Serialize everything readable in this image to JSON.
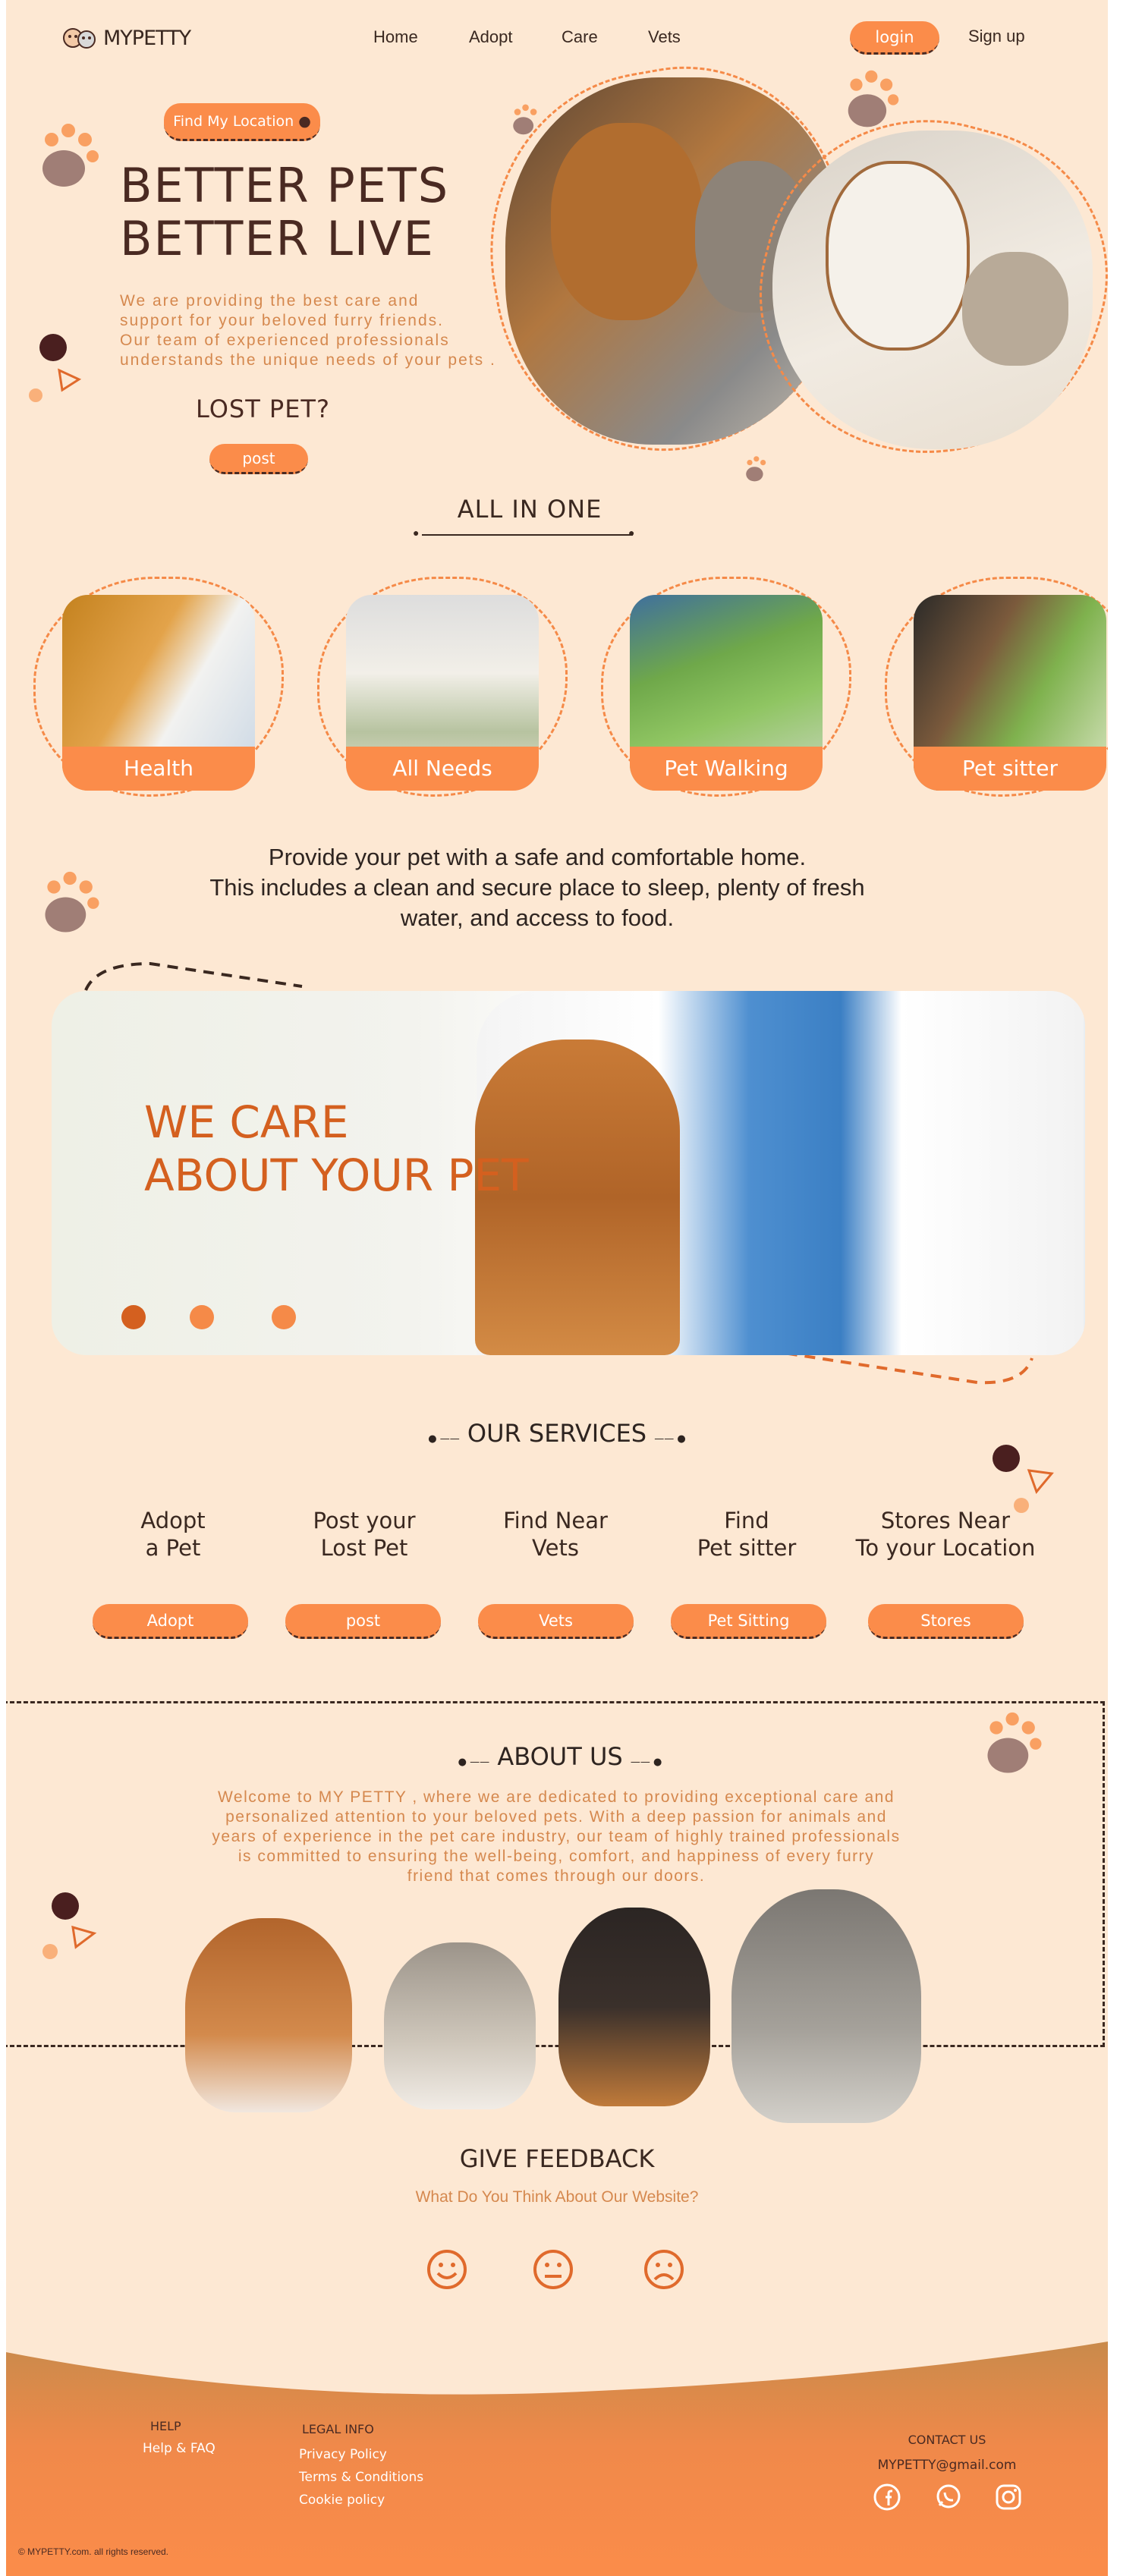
{
  "brand": {
    "name": "MYPETTY"
  },
  "nav": {
    "items": [
      "Home",
      "Adopt",
      "Care",
      "Vets"
    ],
    "login": "login",
    "signup": "Sign up"
  },
  "hero": {
    "location_button": "Find My Location",
    "title_line1": "BETTER PETS",
    "title_line2": "BETTER LIVE",
    "desc_lines": [
      "We are providing the best care and",
      "support for your beloved furry friends.",
      "Our team of experienced professionals",
      "understands the unique needs of your pets ."
    ],
    "lost_title": "LOST PET?",
    "post_button": "post"
  },
  "all_in_one": {
    "heading": "ALL IN ONE",
    "cards": [
      {
        "label": "Health"
      },
      {
        "label": "All Needs"
      },
      {
        "label": "Pet Walking"
      },
      {
        "label": "Pet sitter"
      }
    ]
  },
  "home_text": {
    "lines": [
      "Provide your pet with a safe and comfortable home.",
      "This includes a clean and secure place to sleep, plenty of fresh",
      "water, and access to food."
    ]
  },
  "banner": {
    "line1": "WE CARE",
    "line2": "ABOUT YOUR PET"
  },
  "services": {
    "heading": "OUR SERVICES",
    "items": [
      {
        "title1": "Adopt",
        "title2": "a Pet",
        "button": "Adopt"
      },
      {
        "title1": "Post your",
        "title2": "Lost Pet",
        "button": "post"
      },
      {
        "title1": "Find Near",
        "title2": "Vets",
        "button": "Vets"
      },
      {
        "title1": "Find",
        "title2": "Pet sitter",
        "button": "Pet Sitting"
      },
      {
        "title1": "Stores Near",
        "title2": "To your Location",
        "button": "Stores"
      }
    ]
  },
  "about": {
    "heading": "ABOUT US",
    "lines": [
      "Welcome to MY PETTY , where we are dedicated to providing exceptional care and",
      "personalized attention to your beloved pets. With a deep passion for animals and",
      "years of experience in the pet care industry, our team of highly trained professionals",
      "is committed to ensuring the well-being, comfort, and happiness of every furry",
      "friend that comes through our doors."
    ]
  },
  "feedback": {
    "heading": "GIVE FEEDBACK",
    "sub": "What Do You Think About Our Website?"
  },
  "footer": {
    "help_head": "HELP",
    "help_link": "Help & FAQ",
    "legal_head": "LEGAL INFO",
    "legal_links": [
      "Privacy Policy",
      "Terms & Conditions",
      "Cookie policy"
    ],
    "contact_head": "CONTACT US",
    "email": "MYPETTY@gmail.com",
    "copyright": "© MYPETTY.com. all rights reserved."
  },
  "colors": {
    "accent": "#fb8c4a",
    "dark": "#4a2a22",
    "background": "#fde8d3",
    "footer_top": "#c98a4b"
  }
}
